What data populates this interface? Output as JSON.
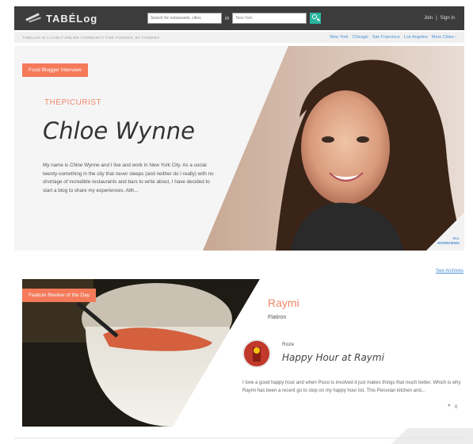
{
  "header": {
    "logo": "TABÉLog",
    "search_placeholder": "Search for restaurants, cities",
    "search_in": "in",
    "city_value": "New York",
    "join": "Join",
    "separator": "|",
    "sign_in": "Sign in"
  },
  "subheader": {
    "tagline": "TABELOG IS A LIVELY ONLINE COMMUNITY FOR FOODIES, BY FOODIES",
    "cities": [
      "New York",
      "Chicago",
      "San Francisco",
      "Los Angeles",
      "More Cities ›"
    ]
  },
  "hero": {
    "badge": "Food Blogger Interview",
    "handle": "THEPICURIST",
    "name": "Chloe Wynne",
    "bio": "My name is Chloe Wynne and I live and work in New York City. As a social twenty-something in the city that never sleeps (and neither do I really) with no shortage of incredible restaurants and bars to write about, I have decided to start a blog to share my experiences. Alth...",
    "all_interviews": [
      "ALL",
      "INTERVIEWS"
    ]
  },
  "archives_link": "See Archives",
  "feature": {
    "badge": "Feature Review of the Day",
    "restaurant": "Raymi",
    "area": "Flatiron",
    "author": "Roze",
    "review_title": "Happy Hour at Raymi",
    "review_body": "I love a good happy hour and when Pisco is involved it just makes things that much better. Which is why Raymi has been a recent go to stop on my happy hour list.    This Peruvian kitchen and...",
    "likes": "0"
  },
  "colors": {
    "accent": "#f47a5a",
    "link": "#4a8fd4",
    "nav_bg": "#3c3c3c",
    "search_button": "#2bb5a0"
  }
}
